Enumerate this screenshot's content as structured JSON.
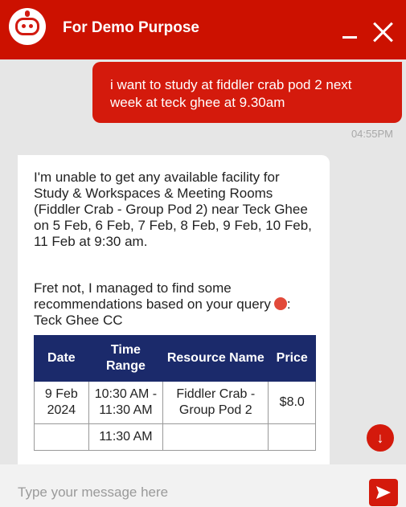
{
  "header": {
    "title": "For Demo Purpose",
    "avatar_icon": "robot-icon",
    "minimize_icon": "minimize-icon",
    "close_icon": "close-icon"
  },
  "user_message": {
    "text": "i want to study at fiddler crab pod 2 next week at teck ghee at 9.30am",
    "time": "04:55PM"
  },
  "bot_message": {
    "line1": "I'm unable to get any available facility for Study & Workspaces & Meeting Rooms (Fiddler Crab - Group Pod 2) near Teck Ghee on 5 Feb, 6 Feb, 7 Feb, 8 Feb, 9 Feb, 10 Feb, 11 Feb at 9:30 am.",
    "line2": "Fret not, I managed to find some recommendations based on your query",
    "location": "Teck Ghee CC",
    "table": {
      "headers": [
        "Date",
        "Time Range",
        "Resource Name",
        "Price"
      ],
      "rows": [
        [
          "9 Feb 2024",
          "10:30 AM - 11:30 AM",
          "Fiddler Crab - Group Pod 2",
          "$8.0"
        ],
        [
          "",
          "11:30 AM",
          "",
          ""
        ]
      ]
    }
  },
  "composer": {
    "placeholder": "Type your message here",
    "send_icon": "send-icon",
    "scroll_icon": "arrow-down-icon"
  },
  "colors": {
    "brand_red": "#cc1100",
    "table_header": "#1b2a6b"
  }
}
